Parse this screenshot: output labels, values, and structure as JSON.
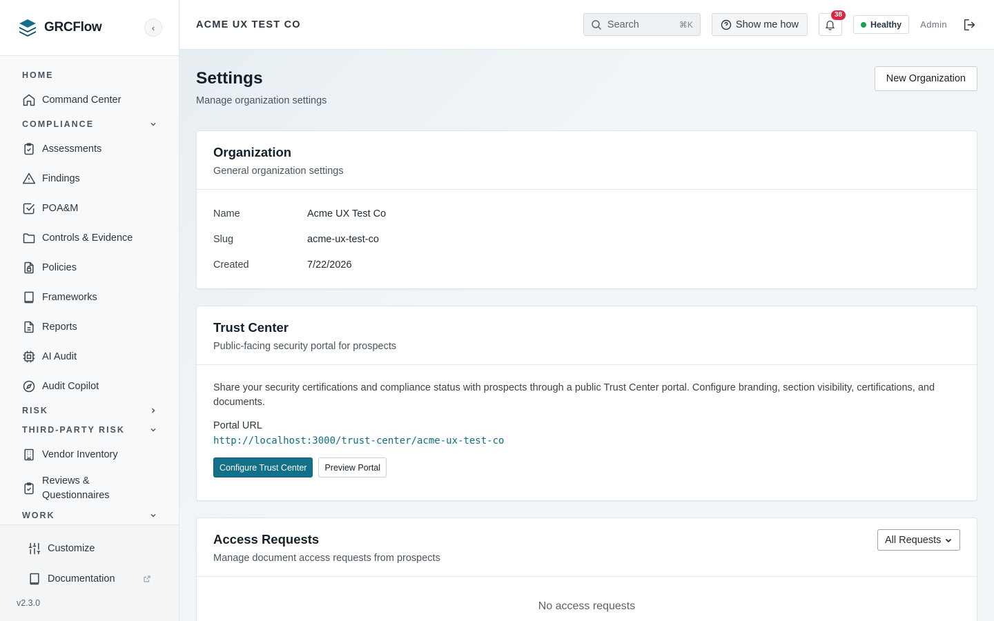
{
  "brand": {
    "name": "GRCFlow",
    "collapse_icon": "‹"
  },
  "sidebar": {
    "home_label": "HOME",
    "command_center": "Command Center",
    "compliance_label": "COMPLIANCE",
    "compliance_items": [
      "Assessments",
      "Findings",
      "POA&M",
      "Controls & Evidence",
      "Policies",
      "Frameworks",
      "Reports",
      "AI Audit",
      "Audit Copilot"
    ],
    "risk_label": "RISK",
    "third_party_label": "THIRD-PARTY RISK",
    "vendor_inventory": "Vendor Inventory",
    "reviews": "Reviews & Questionnaires",
    "work_label": "WORK",
    "customize": "Customize",
    "documentation": "Documentation",
    "version": "v2.3.0"
  },
  "topbar": {
    "org_name": "ACME UX TEST CO",
    "search_placeholder": "Search",
    "search_shortcut": "⌘K",
    "show_me_how": "Show me how",
    "notification_count": "38",
    "health_status": "Healthy",
    "user_role": "Admin"
  },
  "page": {
    "title": "Settings",
    "subtitle": "Manage organization settings",
    "new_org_button": "New Organization"
  },
  "organization_card": {
    "title": "Organization",
    "subtitle": "General organization settings",
    "fields": [
      {
        "label": "Name",
        "value": "Acme UX Test Co"
      },
      {
        "label": "Slug",
        "value": "acme-ux-test-co"
      },
      {
        "label": "Created",
        "value": "7/22/2026"
      }
    ]
  },
  "trust_center_card": {
    "title": "Trust Center",
    "subtitle": "Public-facing security portal for prospects",
    "description": "Share your security certifications and compliance status with prospects through a public Trust Center portal. Configure branding, section visibility, certifications, and documents.",
    "portal_url_label": "Portal URL",
    "portal_url": "http://localhost:3000/trust-center/acme-ux-test-co",
    "configure_button": "Configure Trust Center",
    "preview_button": "Preview Portal"
  },
  "access_requests_card": {
    "title": "Access Requests",
    "subtitle": "Manage document access requests from prospects",
    "filter_value": "All Requests",
    "empty_text": "No access requests"
  },
  "colors": {
    "primary": "#12708a",
    "badge": "#dc2540",
    "healthy": "#16a34a"
  }
}
